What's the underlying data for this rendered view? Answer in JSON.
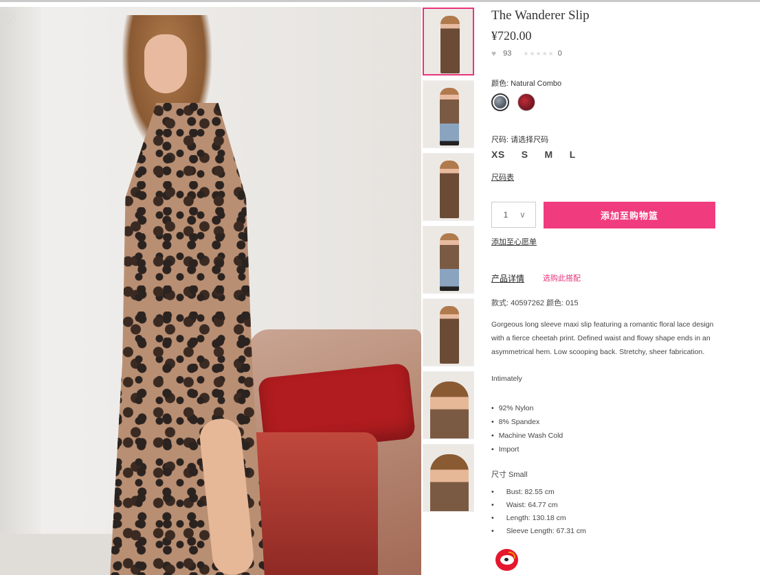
{
  "product": {
    "title": "The Wanderer Slip",
    "price": "¥720.00",
    "likes_count": "93",
    "stars": "★★★★★",
    "reviews_count": "0",
    "color_label": "颜色: Natural Combo",
    "size_label": "尺码: 请选择尺码",
    "sizes": [
      "XS",
      "S",
      "M",
      "L"
    ],
    "size_chart_link": "尺码表",
    "quantity": "1",
    "add_to_cart": "添加至购物篮",
    "add_to_wishlist": "添加至心愿单",
    "tab_details": "产品详情",
    "tab_match": "选购此搭配",
    "sku": "款式: 40597262 颜色: 015",
    "description": "Gorgeous long sleeve maxi slip featuring a romantic floral lace design with a fierce cheetah print. Defined waist and flowy shape ends in an asymmetrical hem. Low scooping back. Stretchy, sheer fabrication.",
    "brand_line": "Intimately",
    "fabric": [
      "92% Nylon",
      "8% Spandex",
      "Machine Wash Cold",
      "Import"
    ],
    "size_heading": "尺寸 Small",
    "measurements": [
      "Bust: 82.55 cm",
      "Waist: 64.77 cm",
      "Length: 130.18 cm",
      "Sleeve Length: 67.31 cm"
    ]
  },
  "icons": {
    "favorite": "heart-outline-icon",
    "like": "heart-icon",
    "chevron": "chevron-down-icon",
    "share": "weibo-icon"
  },
  "colors": {
    "accent": "#f03c7e",
    "link_pink": "#e8337a",
    "text": "#333333"
  }
}
